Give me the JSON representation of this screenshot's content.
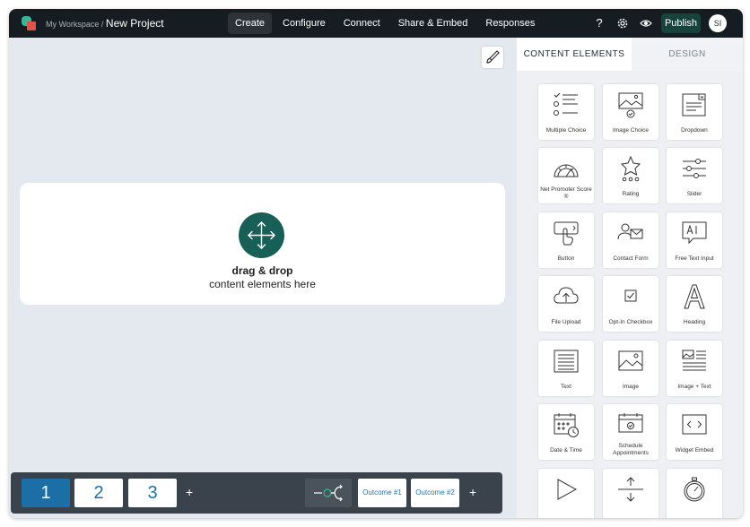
{
  "header": {
    "workspace": "My Workspace",
    "separator": "/",
    "project": "New Project",
    "tabs": [
      "Create",
      "Configure",
      "Connect",
      "Share & Embed",
      "Responses"
    ],
    "active_tab": "Create",
    "help_label": "?",
    "publish_label": "Publish",
    "avatar_initials": "SI"
  },
  "canvas": {
    "drop_title": "drag & drop",
    "drop_subtitle": "content elements here"
  },
  "pages": {
    "items": [
      "1",
      "2",
      "3"
    ],
    "active": "1",
    "add_label": "+",
    "outcomes": [
      "Outcome #1",
      "Outcome #2"
    ],
    "add_outcome_label": "+"
  },
  "panel": {
    "tab_content": "CONTENT ELEMENTS",
    "tab_design": "DESIGN",
    "elements": [
      "Multiple Choice",
      "Image Choice",
      "Dropdown",
      "Net Promoter Score ®",
      "Rating",
      "Slider",
      "Button",
      "Contact Form",
      "Free Text Input",
      "File Upload",
      "Opt-In Checkbox",
      "Heading",
      "Text",
      "Image",
      "Image + Text",
      "Date & Time",
      "Schedule Appointments",
      "Widget Embed",
      "",
      "",
      ""
    ]
  },
  "colors": {
    "topbar": "#161d22",
    "accent_teal": "#185f57",
    "page_active": "#1c6ea6",
    "canvas_bg": "#e4e8ef"
  }
}
